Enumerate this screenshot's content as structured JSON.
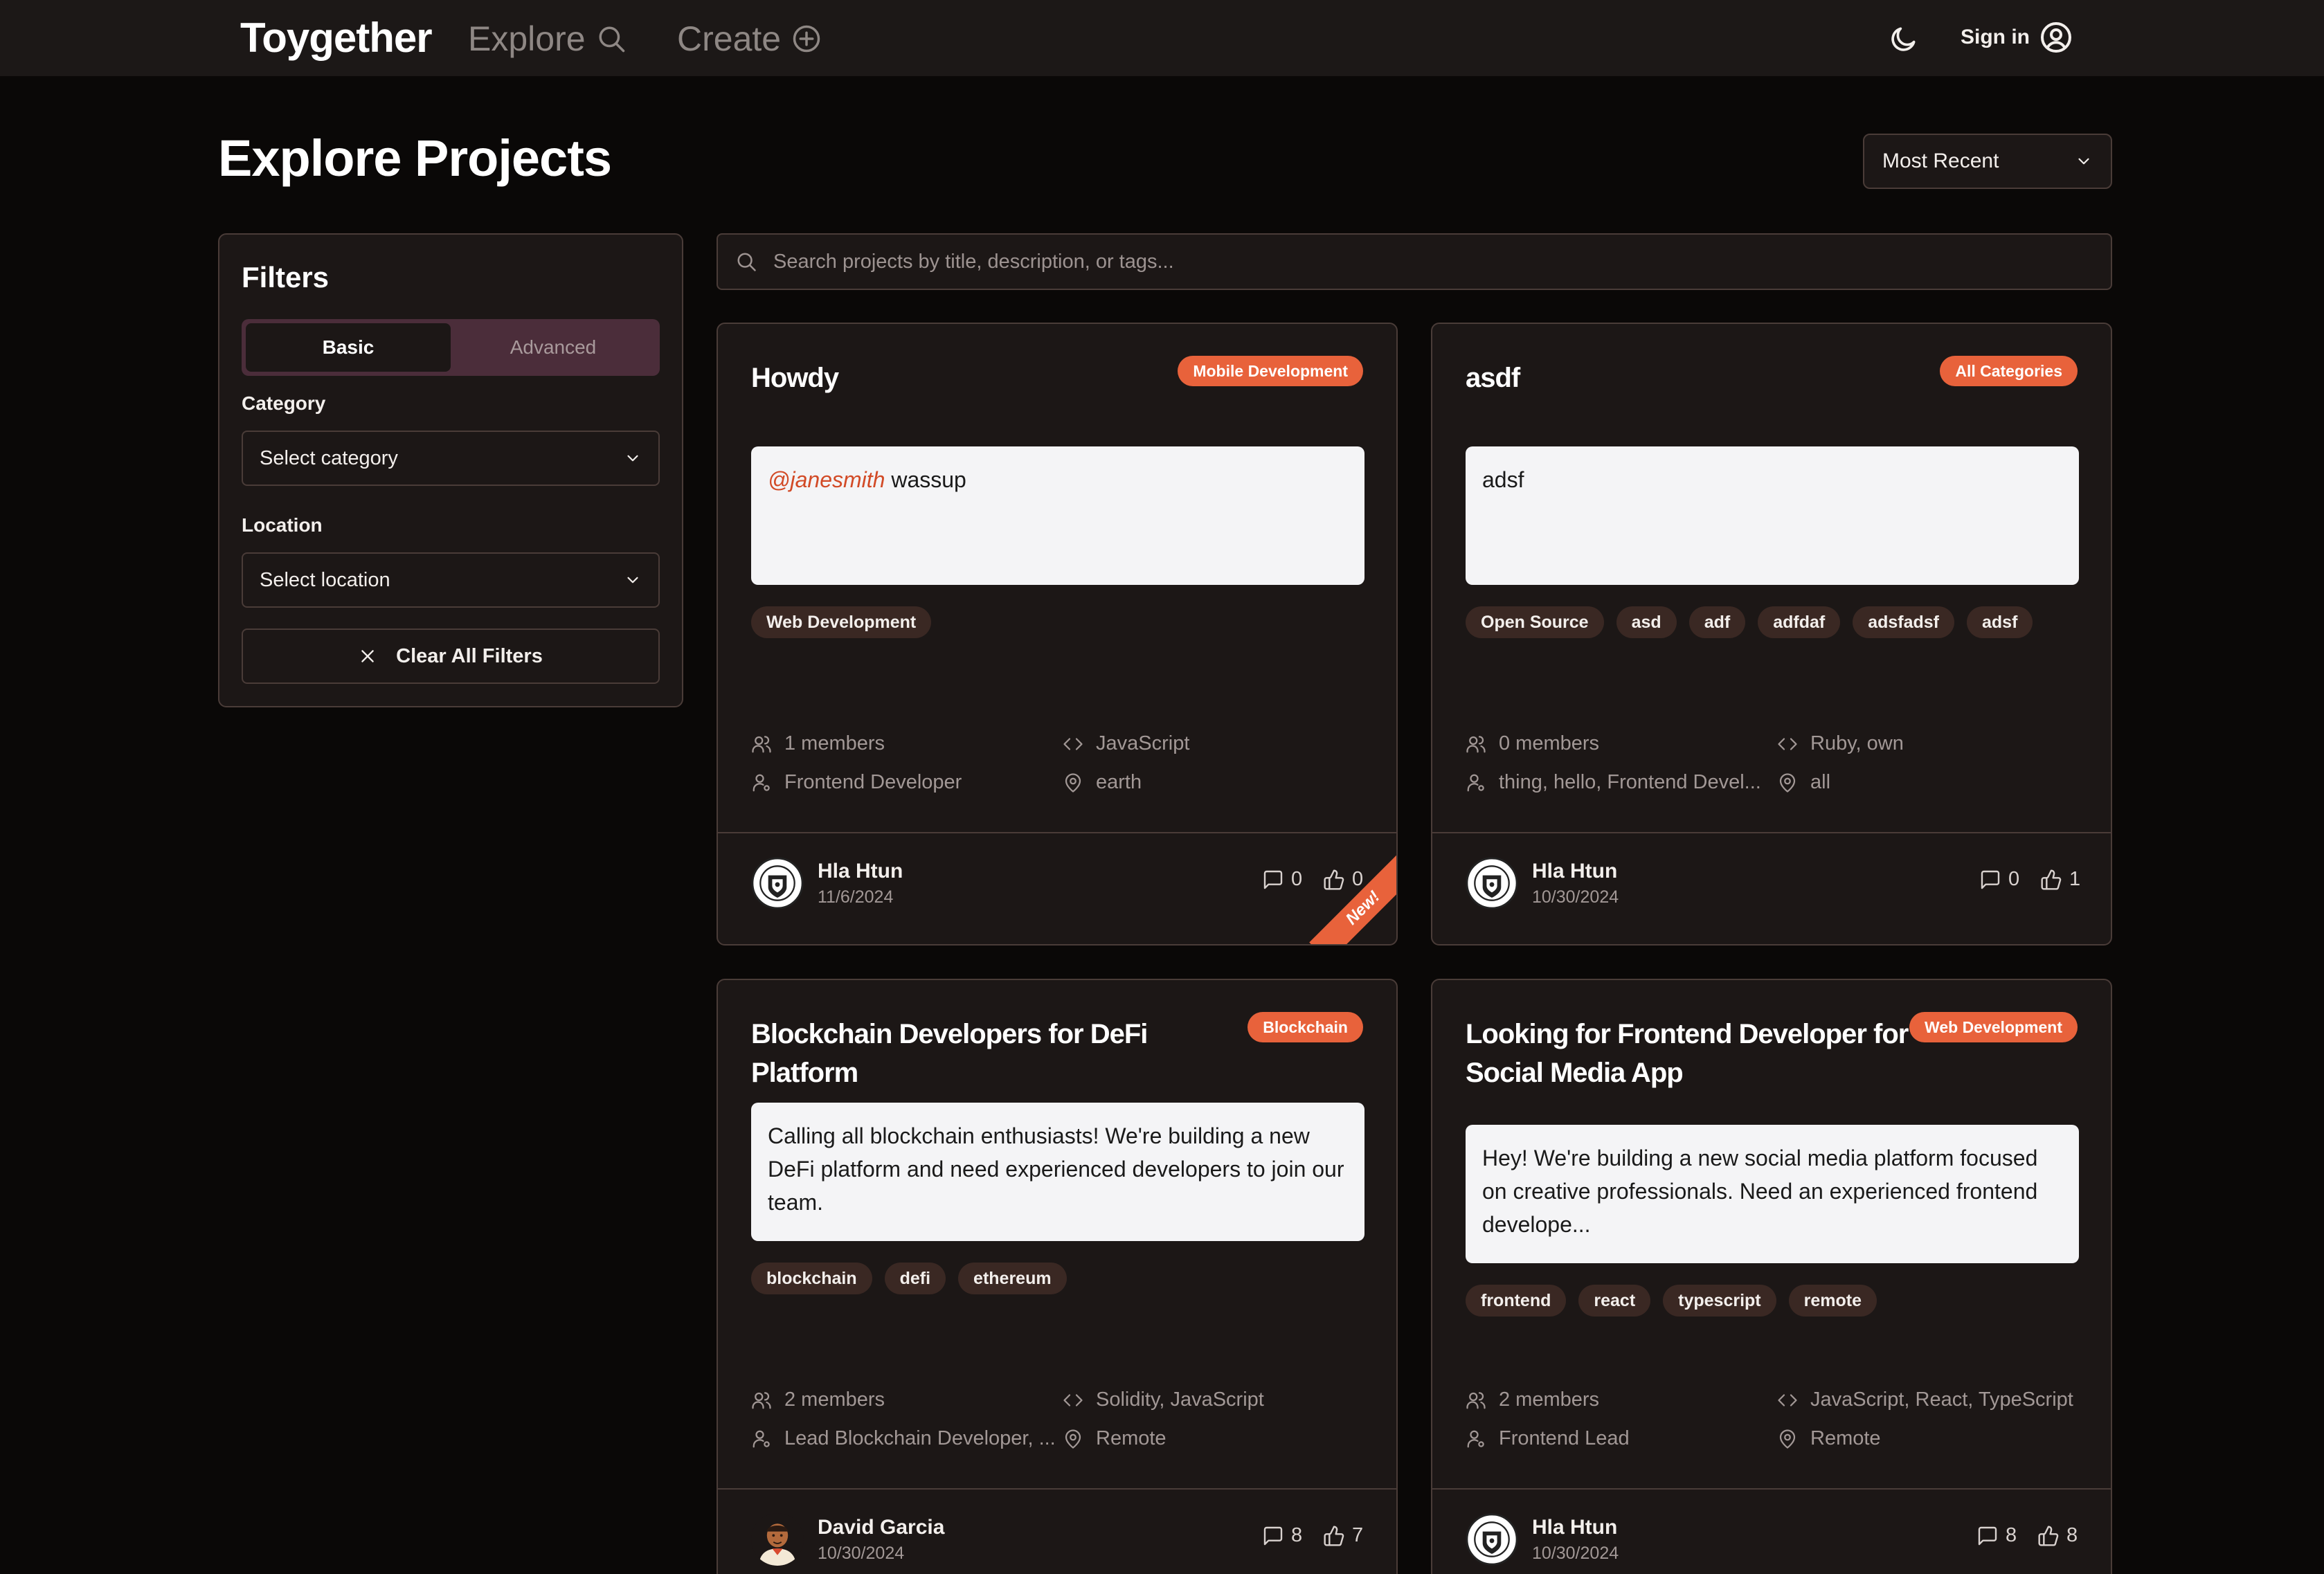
{
  "nav": {
    "brand": "Toygether",
    "explore": "Explore",
    "create": "Create",
    "signin": "Sign in"
  },
  "page": {
    "title": "Explore Projects",
    "sort": "Most Recent",
    "search_placeholder": "Search projects by title, description, or tags..."
  },
  "filters": {
    "title": "Filters",
    "tab_basic": "Basic",
    "tab_advanced": "Advanced",
    "category_label": "Category",
    "category_value": "Select category",
    "location_label": "Location",
    "location_value": "Select location",
    "clear": "Clear All Filters"
  },
  "cards": [
    {
      "title": "Howdy",
      "badge": "Mobile Development",
      "mention": "@janesmith",
      "description": " wassup",
      "tags": [
        "Web Development"
      ],
      "members": "1 members",
      "languages": "JavaScript",
      "roles": "Frontend Developer",
      "location": "earth",
      "author": "Hla Htun",
      "date": "11/6/2024",
      "comments": "0",
      "likes": "0",
      "ribbon": "New!"
    },
    {
      "title": "asdf",
      "badge": "All Categories",
      "description": "adsf",
      "tags": [
        "Open Source",
        "asd",
        "adf",
        "adfdaf",
        "adsfadsf",
        "adsf"
      ],
      "members": "0 members",
      "languages": "Ruby, own",
      "roles": "thing, hello, Frontend Devel...",
      "location": "all",
      "author": "Hla Htun",
      "date": "10/30/2024",
      "comments": "0",
      "likes": "1"
    },
    {
      "title": "Blockchain Developers for DeFi Platform",
      "badge": "Blockchain",
      "description": "Calling all blockchain enthusiasts! We're building a new DeFi platform and need experienced developers to join our team.",
      "tags": [
        "blockchain",
        "defi",
        "ethereum"
      ],
      "members": "2 members",
      "languages": "Solidity, JavaScript",
      "roles": "Lead Blockchain Developer, ...",
      "location": "Remote",
      "author": "David Garcia",
      "date": "10/30/2024",
      "comments": "8",
      "likes": "7"
    },
    {
      "title": "Looking for Frontend Developer for Social Media App",
      "badge": "Web Development",
      "description": "Hey! We're building a new social media platform focused on creative professionals. Need an experienced frontend develope...",
      "tags": [
        "frontend",
        "react",
        "typescript",
        "remote"
      ],
      "members": "2 members",
      "languages": "JavaScript, React, TypeScript",
      "roles": "Frontend Lead",
      "location": "Remote",
      "author": "Hla Htun",
      "date": "10/30/2024",
      "comments": "8",
      "likes": "8"
    }
  ],
  "colors": {
    "accent": "#e8623b",
    "background": "#0a0807",
    "surface": "#1c1716",
    "border": "#4a3c38"
  },
  "icons": {
    "explore": "search-icon",
    "create": "plus-circle-icon",
    "theme": "moon-icon",
    "signin": "user-circle-icon",
    "members": "users-icon",
    "languages": "code-icon",
    "roles": "user-icon",
    "location": "map-pin-icon",
    "comments": "message-square-icon",
    "likes": "thumbs-up-icon"
  }
}
